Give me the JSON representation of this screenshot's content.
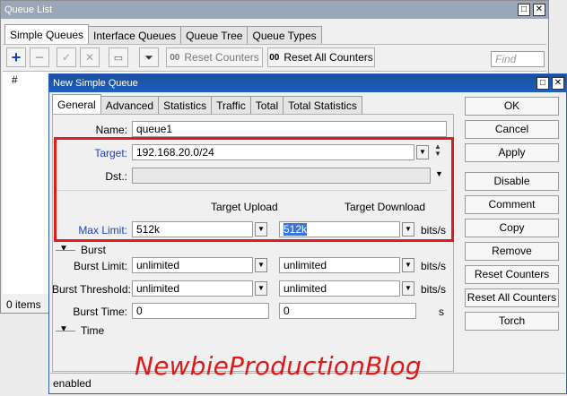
{
  "queue_list": {
    "title": "Queue List",
    "tabs": [
      "Simple Queues",
      "Interface Queues",
      "Queue Tree",
      "Queue Types"
    ],
    "toolbar": {
      "reset_counters": "Reset Counters",
      "reset_all_counters": "Reset All Counters",
      "find_placeholder": "Find",
      "oo": "00"
    },
    "table_header_hash": "#",
    "status": "0 items"
  },
  "dialog": {
    "title": "New Simple Queue",
    "tabs": [
      "General",
      "Advanced",
      "Statistics",
      "Traffic",
      "Total",
      "Total Statistics"
    ],
    "name_label": "Name:",
    "name_value": "queue1",
    "target_label": "Target:",
    "target_value": "192.168.20.0/24",
    "dst_label": "Dst.:",
    "dst_value": "",
    "col_upload": "Target Upload",
    "col_download": "Target Download",
    "max_limit_label": "Max Limit:",
    "max_limit_upload": "512k",
    "max_limit_download": "512k",
    "burst_section": "Burst",
    "burst_limit_label": "Burst Limit:",
    "burst_limit_upload": "unlimited",
    "burst_limit_download": "unlimited",
    "burst_threshold_label": "Burst Threshold:",
    "burst_threshold_upload": "unlimited",
    "burst_threshold_download": "unlimited",
    "burst_time_label": "Burst Time:",
    "burst_time_upload": "0",
    "burst_time_download": "0",
    "time_section": "Time",
    "unit_bits": "bits/s",
    "unit_s": "s",
    "status": "enabled",
    "buttons": {
      "ok": "OK",
      "cancel": "Cancel",
      "apply": "Apply",
      "disable": "Disable",
      "comment": "Comment",
      "copy": "Copy",
      "remove": "Remove",
      "reset_counters": "Reset Counters",
      "reset_all_counters": "Reset All Counters",
      "torch": "Torch"
    }
  },
  "watermark": "NewbieProductionBlog",
  "colors": {
    "highlight": "#e01d1d",
    "title_active": "#1e5fbf",
    "label_blue": "#1c3fbf"
  }
}
